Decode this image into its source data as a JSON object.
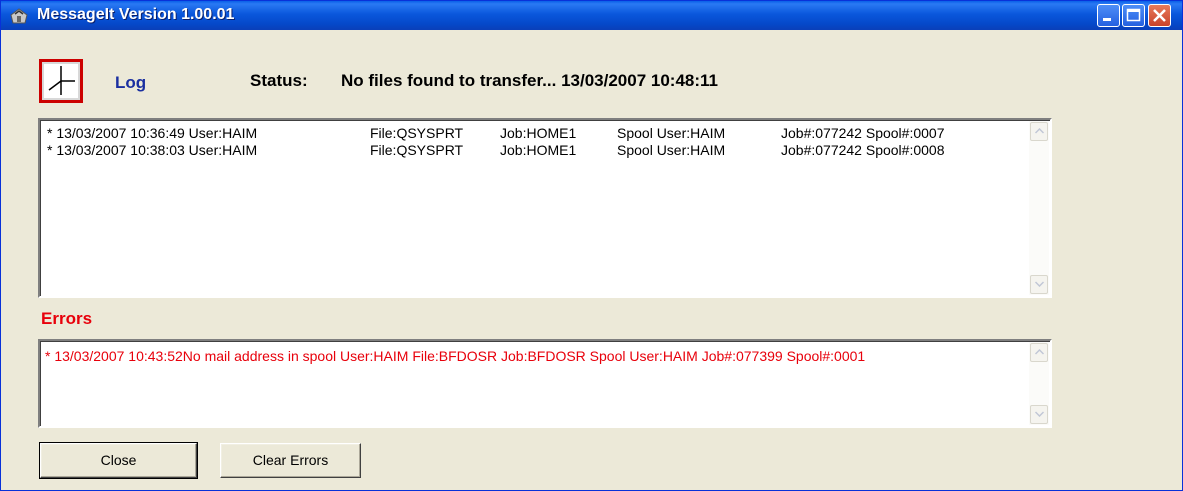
{
  "window": {
    "title": "MessageIt Version 1.00.01",
    "controls": [
      "minimize-icon",
      "maximize-icon",
      "close-icon"
    ]
  },
  "header": {
    "log_label": "Log",
    "status_label": "Status:",
    "status_text": "No files found to transfer... 13/03/2007 10:48:11"
  },
  "log": {
    "rows": [
      {
        "time": "* 13/03/2007 10:36:49 User:HAIM",
        "file": "File:QSYSPRT",
        "job": "Job:HOME1",
        "spool_user": "Spool User:HAIM",
        "numbers": "Job#:077242 Spool#:0007"
      },
      {
        "time": "* 13/03/2007 10:38:03 User:HAIM",
        "file": "File:QSYSPRT",
        "job": "Job:HOME1",
        "spool_user": "Spool User:HAIM",
        "numbers": "Job#:077242 Spool#:0008"
      }
    ]
  },
  "errors": {
    "label": "Errors",
    "text": " * 13/03/2007 10:43:52No mail address in spool User:HAIM File:BFDOSR Job:BFDOSR Spool User:HAIM Job#:077399 Spool#:0001"
  },
  "buttons": {
    "close_label": "Close",
    "clear_errors_label": "Clear Errors"
  },
  "colors": {
    "title_bar": "#0a57dc",
    "error_text": "#e8000b",
    "log_label": "#1a2fa0",
    "clock_border": "#cc0000",
    "window_bg": "#ece9d8"
  }
}
